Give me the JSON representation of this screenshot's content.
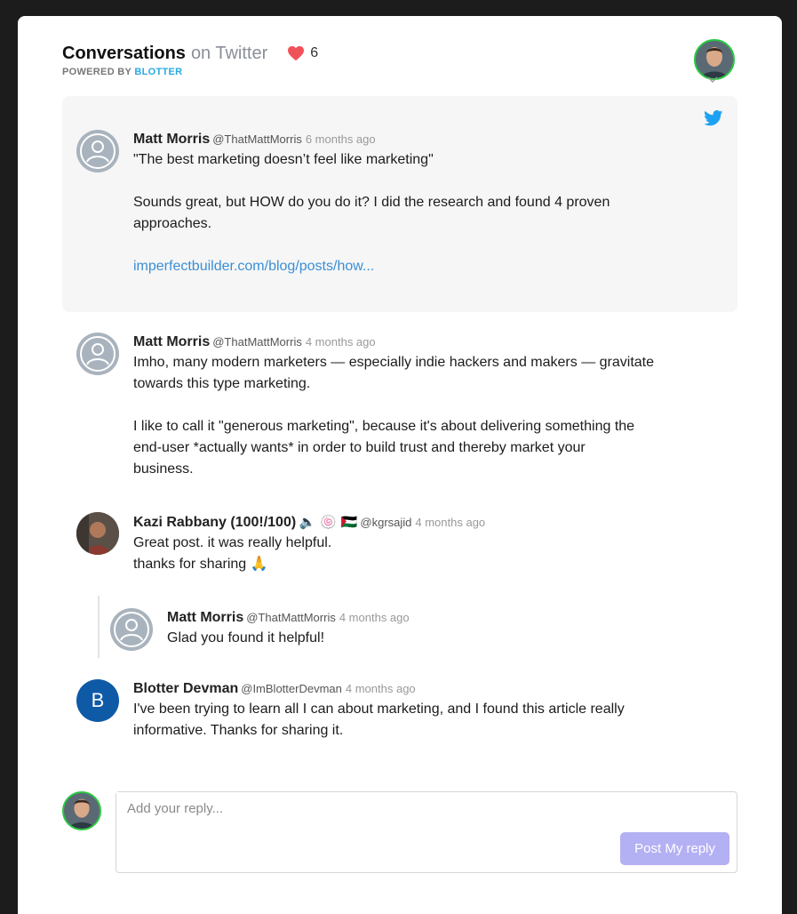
{
  "header": {
    "title_strong": "Conversations",
    "title_rest": "on Twitter",
    "likes_count": "6",
    "powered_prefix": "POWERED BY",
    "powered_brand": "BLOTTER"
  },
  "comments": [
    {
      "name": "Matt Morris",
      "handle": "@ThatMattMorris",
      "time": "6 months ago",
      "text": "\"The best marketing doesn’t feel like marketing\"\n\nSounds great, but HOW do you do it? I did the research and found 4 proven\napproaches.",
      "link": "imperfectbuilder.com/blog/posts/how..."
    },
    {
      "name": "Matt Morris",
      "handle": "@ThatMattMorris",
      "time": "4 months ago",
      "text": "Imho, many modern marketers — especially indie hackers and makers — gravitate\ntowards this type marketing.\n\nI like to call it \"generous marketing\", because it's about delivering something the\nend-user *actually wants* in order to build trust and thereby market your\nbusiness."
    },
    {
      "name": "Kazi Rabbany (100!/100)",
      "name_emojis": "🔈 🍥 🇵🇸",
      "handle": "@kgrsajid",
      "time": "4 months ago",
      "text": "Great post. it was really helpful.\nthanks for sharing 🙏"
    },
    {
      "name": "Matt Morris",
      "handle": "@ThatMattMorris",
      "time": "4 months ago",
      "text": "Glad you found it helpful!"
    },
    {
      "name": "Blotter Devman",
      "handle": "@ImBlotterDevman",
      "time": "4 months ago",
      "avatar_letter": "B",
      "text": "I've been trying to learn all I can about marketing, and I found this article really\ninformative. Thanks for sharing it."
    }
  ],
  "reply": {
    "placeholder": "Add your reply...",
    "button_label": "Post My reply"
  },
  "colors": {
    "accent_link": "#3a8fd6",
    "brand": "#29a9e1",
    "twitter": "#1da1f2",
    "heart": "#f0525a",
    "button": "#b4b0f4"
  },
  "icons": [
    "heart-icon",
    "twitter-icon",
    "chevron-down-icon",
    "user-placeholder-icon"
  ]
}
